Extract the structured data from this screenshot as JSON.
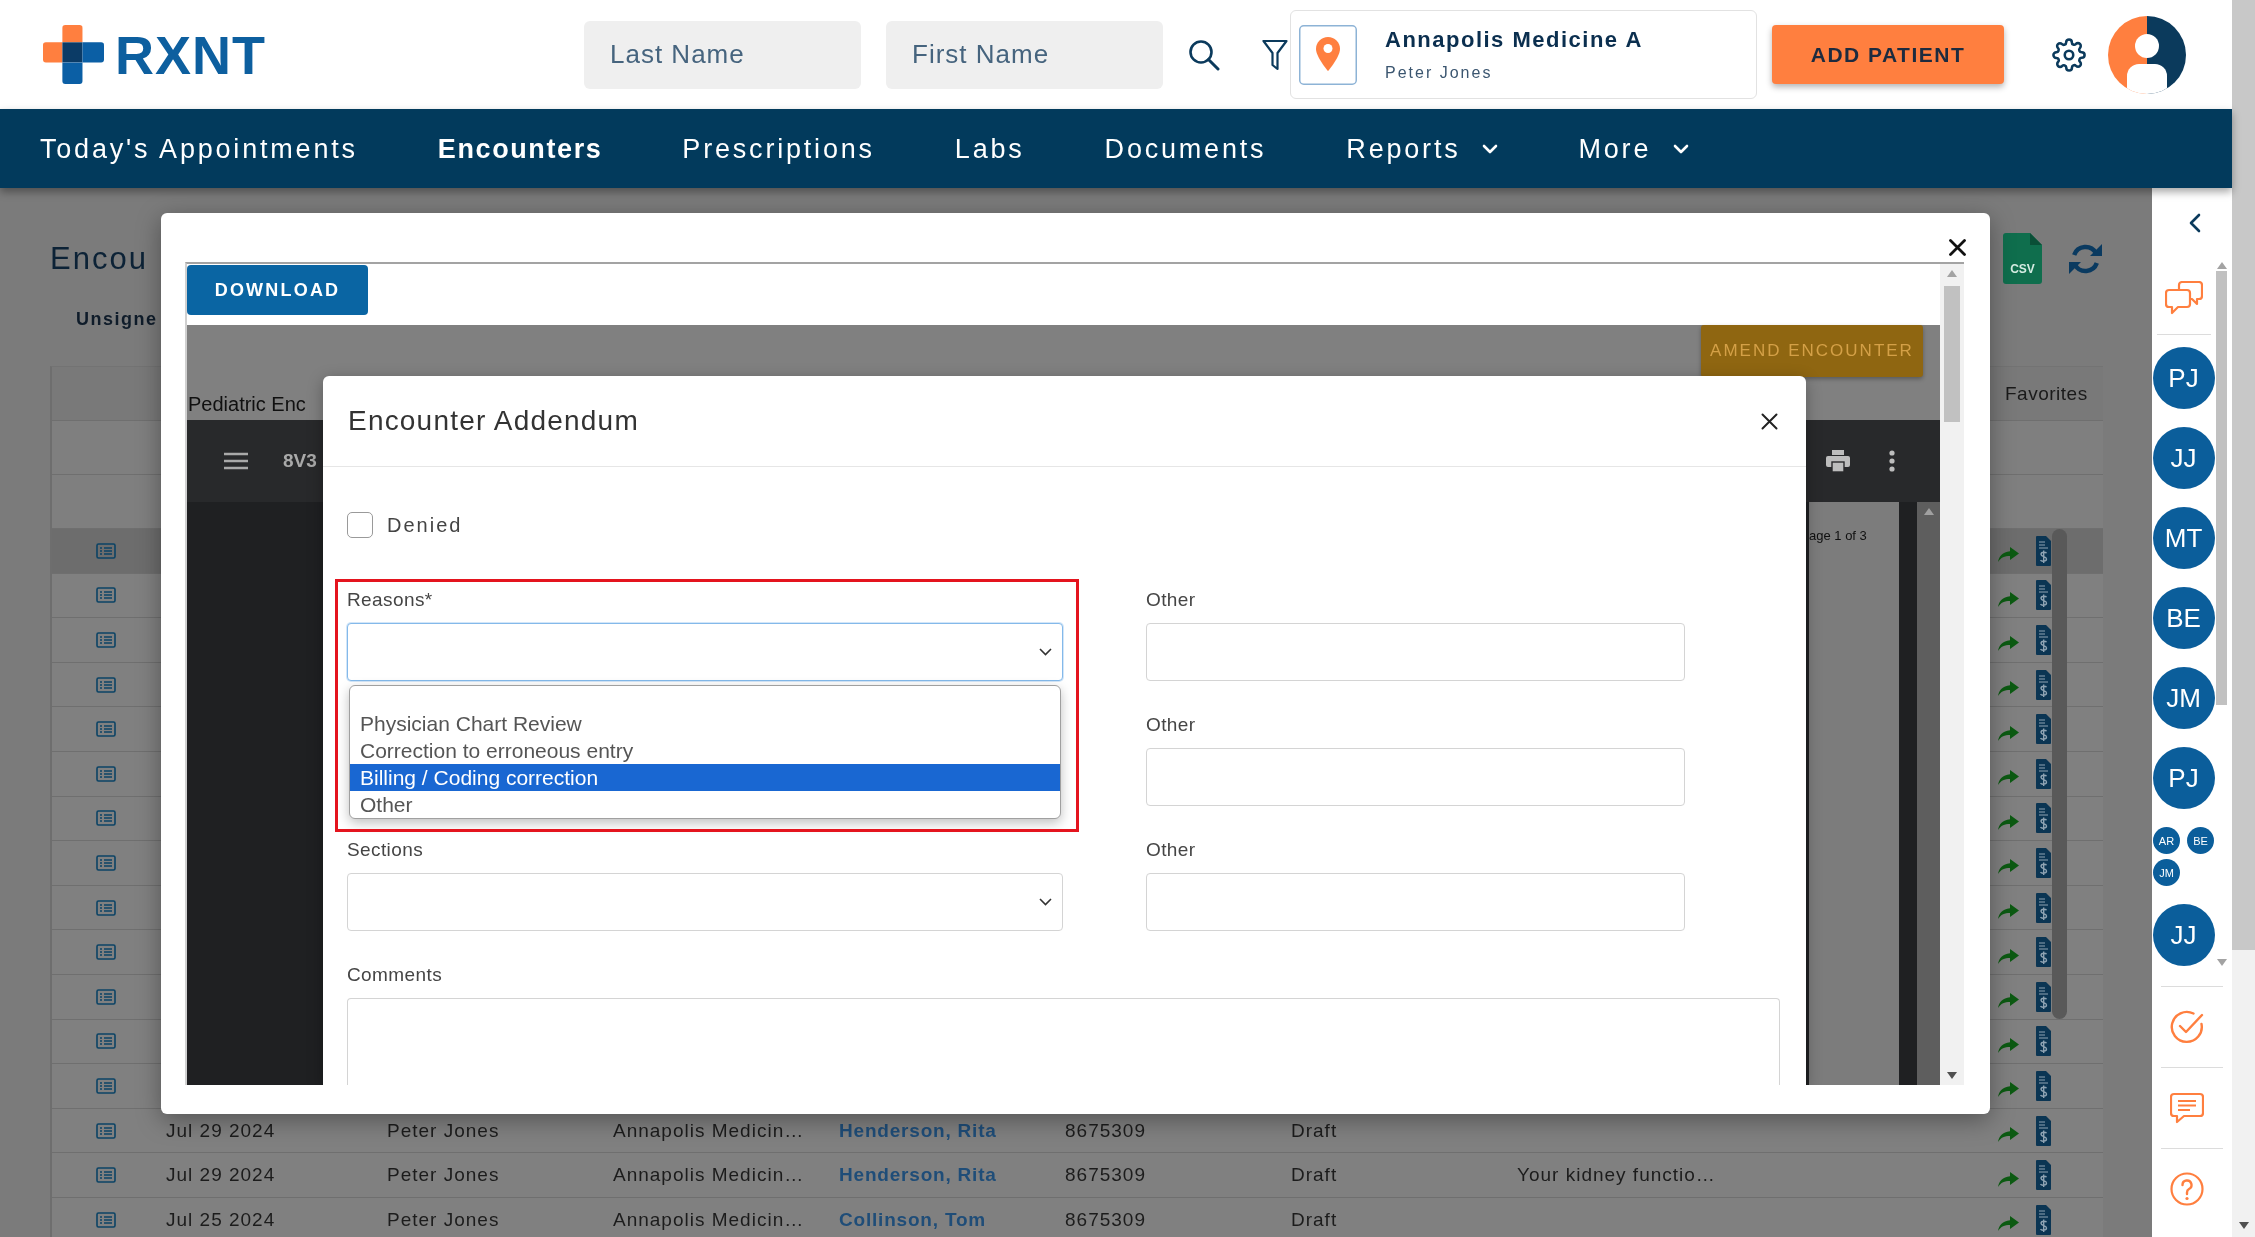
{
  "header": {
    "logo": "RXNT",
    "search_fields": [
      {
        "placeholder": "Last Name"
      },
      {
        "placeholder": "First Name"
      }
    ],
    "location": {
      "name": "Annapolis Medicine A",
      "user": "Peter Jones"
    },
    "add_button": "ADD PATIENT"
  },
  "nav": [
    {
      "label": "Today's Appointments",
      "selected": false,
      "dropdown": false
    },
    {
      "label": "Encounters",
      "selected": true,
      "dropdown": false
    },
    {
      "label": "Prescriptions",
      "selected": false,
      "dropdown": false
    },
    {
      "label": "Labs",
      "selected": false,
      "dropdown": false
    },
    {
      "label": "Documents",
      "selected": false,
      "dropdown": false
    },
    {
      "label": "Reports",
      "selected": false,
      "dropdown": true
    },
    {
      "label": "More",
      "selected": false,
      "dropdown": true
    }
  ],
  "page": {
    "title": "Encou",
    "tab": "Unsigne",
    "csv_icon_label": "CSV",
    "table": {
      "header": "Favorites",
      "rows": [
        {
          "selected": true
        },
        {
          "selected": false
        },
        {
          "selected": false
        },
        {
          "selected": false
        },
        {
          "selected": false
        },
        {
          "selected": false
        },
        {
          "selected": false
        },
        {
          "selected": false
        },
        {
          "selected": false
        },
        {
          "selected": false
        },
        {
          "selected": false
        },
        {
          "selected": false
        },
        {
          "selected": false
        },
        {
          "selected": false,
          "cells": [
            "Jul 29 2024",
            "Peter Jones",
            "Annapolis Medicin…",
            "Henderson, Rita",
            "8675309",
            "Draft"
          ]
        },
        {
          "selected": false,
          "cells": [
            "Jul 29 2024",
            "Peter Jones",
            "Annapolis Medicin…",
            "Henderson, Rita",
            "8675309",
            "Draft"
          ],
          "column_7": "Your kidney functio…"
        },
        {
          "selected": false,
          "cells": [
            "Jul 25 2024",
            "Peter Jones",
            "Annapolis Medicin…",
            "Collinson, Tom",
            "8675309",
            "Draft"
          ]
        }
      ]
    }
  },
  "viewer": {
    "download_button": "DOWNLOAD",
    "document_title": "Pediatric Enc",
    "amend_button": "AMEND ENCOUNTER",
    "file_name": "8V3",
    "page_indicator": "age 1 of 3"
  },
  "addendum_dialog": {
    "title": "Encounter Addendum",
    "denied": {
      "label": "Denied",
      "checked": false
    },
    "rows": [
      {
        "left": {
          "kind": "select",
          "label": "Reasons*",
          "open": true,
          "highlighted": true,
          "options": [
            {
              "label": "Physician Chart Review",
              "selected": false
            },
            {
              "label": "Correction to erroneous entry",
              "selected": false
            },
            {
              "label": "Billing / Coding correction",
              "selected": true
            },
            {
              "label": "Other",
              "selected": false
            }
          ]
        },
        "right": {
          "kind": "input",
          "label": "Other"
        }
      },
      {
        "right": {
          "kind": "input",
          "label": "Other"
        }
      },
      {
        "left": {
          "kind": "select",
          "label": "Sections",
          "open": false,
          "highlighted": false
        },
        "right": {
          "kind": "input",
          "label": "Other"
        }
      }
    ],
    "comments": {
      "label": "Comments"
    }
  },
  "sidebar": {
    "contacts": [
      {
        "kind": "single",
        "initials": "PJ"
      },
      {
        "kind": "single",
        "initials": "JJ"
      },
      {
        "kind": "single",
        "initials": "MT"
      },
      {
        "kind": "single",
        "initials": "BE"
      },
      {
        "kind": "single",
        "initials": "JM"
      },
      {
        "kind": "single",
        "initials": "PJ"
      },
      {
        "kind": "group",
        "members": [
          "AR",
          "BE",
          "JM"
        ]
      },
      {
        "kind": "single",
        "initials": "JJ"
      }
    ]
  }
}
